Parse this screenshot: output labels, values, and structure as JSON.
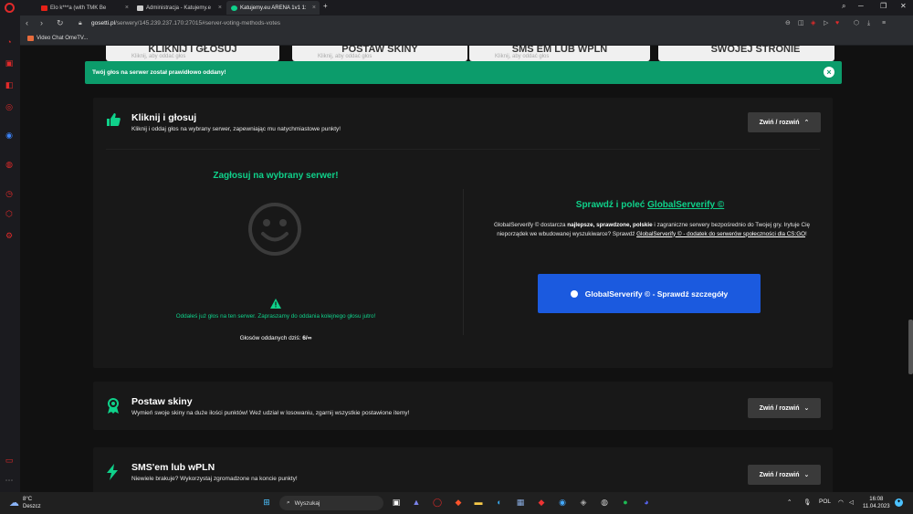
{
  "browser": {
    "tabs": [
      {
        "label": "Elo k***a (with TMK Be"
      },
      {
        "label": "Administracja - Katujemy.e"
      },
      {
        "label": "Katujemy.eu ARENA 1v1 1:"
      }
    ],
    "new_tab": "+",
    "url_host": "gosetti.pl",
    "url_path": "/serwery/145.239.237.170:27015#server-voting-methods-votes",
    "bookmark": "Video Chat OmeTV..."
  },
  "top_cards": [
    {
      "title": "KLIKNIJ I GŁOSUJ",
      "sub": "Kliknij, aby oddać głos"
    },
    {
      "title": "POSTAW SKINY",
      "sub": "Kliknij, aby oddać głos"
    },
    {
      "title": "SMS EM LUB WPLN",
      "sub": "Kliknij, aby oddać głos"
    },
    {
      "title": "SWOJEJ STRONIE",
      "sub": ""
    }
  ],
  "toast": {
    "text": "Twój głos na serwer został prawidłowo oddany!",
    "close": "×"
  },
  "sections": {
    "click_vote": {
      "title": "Kliknij i głosuj",
      "desc": "Kliknij i oddaj głos na wybrany serwer, zapewniając mu natychmiastowe punkty!",
      "toggle": "Zwiń / rozwiń",
      "vote_title": "Zagłosuj na wybrany serwer!",
      "vote_msg": "Oddałeś już głos na ten serwer. Zapraszamy do oddania kolejnego głosu jutro!",
      "votes_label": "Głosów oddanych dziś:",
      "votes_value": "6/∞",
      "gs_title_prefix": "Sprawdź i poleć",
      "gs_title_link": "GlobalServerify ©",
      "gs_desc_1": "GlobalServerify © dostarcza",
      "gs_desc_bold": "najlepsze, sprawdzone, polskie",
      "gs_desc_2": "i zagraniczne serwery bezpośrednio do Twojej gry. Irytuje Cię nieporządek we wbudowanej wyszukiwarce? Sprawdź",
      "gs_desc_link": "GlobalServerify © - dodatek do serwerów społeczności dla CS:GO",
      "gs_desc_end": "!",
      "gs_button": "GlobalServerify © - Sprawdź szczegóły"
    },
    "skins": {
      "title": "Postaw skiny",
      "desc": "Wymień swoje skiny na duże ilości punktów! Weź udział w losowaniu, zgarnij wszystkie postawione itemy!",
      "toggle": "Zwiń / rozwiń"
    },
    "sms": {
      "title": "SMS'em lub wPLN",
      "desc": "Niewiele brakuje? Wykorzystaj zgromadzone na koncie punkty!",
      "toggle": "Zwiń / rozwiń"
    }
  },
  "taskbar": {
    "temp": "8°C",
    "weather": "Deszcz",
    "search": "Wyszukaj",
    "lang": "POL",
    "time": "16:08",
    "date": "11.04.2023"
  },
  "colors": {
    "accent": "#0fd18a",
    "toast": "#0c9c6b",
    "button_blue": "#1b5adf",
    "opera_red": "#e02a2a"
  }
}
